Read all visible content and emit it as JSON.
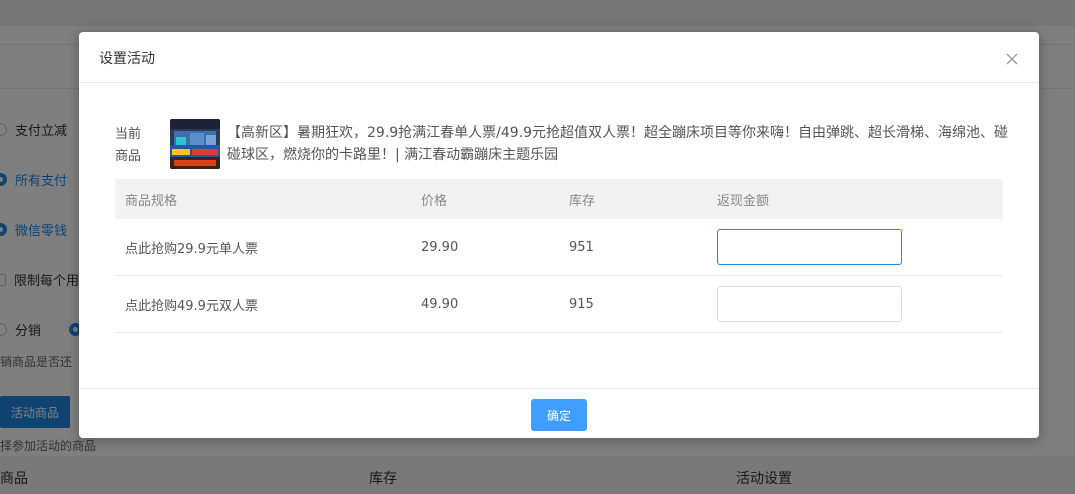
{
  "background": {
    "options": {
      "pay_reduce": "支付立减",
      "all_payment": "所有支付",
      "wechat_change": "微信零钱",
      "limit_per_user": "限制每个用",
      "distribution": "分销"
    },
    "hint_distribution": "销商品是否还",
    "activity_product_button": "活动商品",
    "hint_select": "择参加活动的商品",
    "table_headers": {
      "product": "商品",
      "stock": "库存",
      "activity_settings": "活动设置"
    },
    "colors": {
      "accent": "#1e88e5"
    }
  },
  "dialog": {
    "title": "设置活动",
    "close_icon": "close-icon",
    "current_product_label": "当前商品",
    "product_title": "【高新区】暑期狂欢，29.9抢满江春单人票/49.9元抢超值双人票！超全蹦床项目等你来嗨！自由弹跳、超长滑梯、海绵池、碰碰球区，燃烧你的卡路里！| 满江春动霸蹦床主题乐园",
    "table": {
      "headers": {
        "spec": "商品规格",
        "price": "价格",
        "stock": "库存",
        "cashback": "返现金额"
      },
      "rows": [
        {
          "spec": "点此抢购29.9元单人票",
          "price": "29.90",
          "stock": "951",
          "cashback": ""
        },
        {
          "spec": "点此抢购49.9元双人票",
          "price": "49.90",
          "stock": "915",
          "cashback": ""
        }
      ]
    },
    "confirm_label": "确定",
    "colors": {
      "primary_button": "#409eff"
    }
  }
}
